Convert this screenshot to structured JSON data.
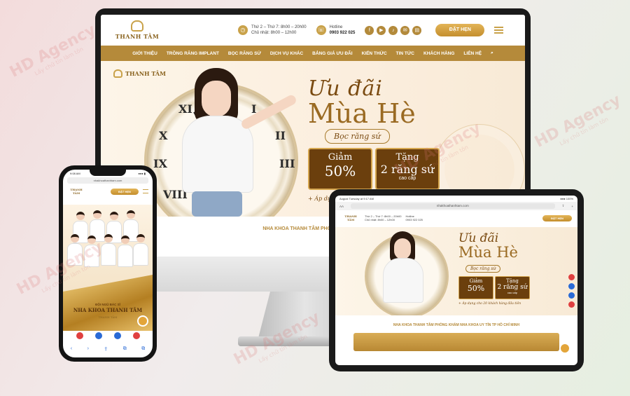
{
  "watermark": {
    "brand": "HD Agency",
    "tagline": "Lấy chữ tín làm tôn"
  },
  "desktop": {
    "logo_text": "THANH TÂM",
    "hours_line1": "Thứ 2 – Thứ 7: 8h00 – 20h00",
    "hours_line2": "Chủ nhật: 8h00 – 12h00",
    "hotline_label": "Hotline",
    "hotline": "0903 922 025",
    "socials": [
      "f",
      "▶",
      "♪",
      "✉",
      "▤"
    ],
    "book_button": "ĐẶT HẸN",
    "nav": [
      "GIỚI THIỆU",
      "TRỒNG RĂNG IMPLANT",
      "BỌC RĂNG SỨ",
      "DỊCH VỤ KHÁC",
      "BẢNG GIÁ ƯU ĐÃI",
      "KIẾN THỨC",
      "TIN TỨC",
      "KHÁCH HÀNG",
      "LIÊN HỆ"
    ],
    "search_icon": "⌕",
    "hero": {
      "script_title": "Ưu đãi",
      "big_title": "Mùa Hè",
      "pill": "Bọc răng sứ",
      "box1_l1": "Giảm",
      "box1_l2": "50%",
      "box2_l1": "Tặng",
      "box2_l2": "2 răng sứ",
      "box2_l3": "cao cấp",
      "note": "+ Áp dụ"
    },
    "section_title": "NHA KHOA THANH TÂM PHÒNG KHÁM NH"
  },
  "tablet": {
    "status_left": "August Tuesday at 9:17 AM",
    "status_right": "●●● 100%",
    "url_left": "AA",
    "url": "nhakhoathanhtam.com",
    "logo_text": "THANH TÂM",
    "hours_line1": "Thứ 2 – Thứ 7: 8h00 – 20h00",
    "hours_line2": "Chủ nhật: 8h00 – 12h00",
    "hotline_label": "Hotline",
    "hotline": "0903 922 025",
    "book_button": "ĐẶT HẸN",
    "hero": {
      "script_title": "Ưu đãi",
      "big_title": "Mùa Hè",
      "pill": "Bọc răng sứ",
      "box1_l1": "Giảm",
      "box1_l2": "50%",
      "box2_l1": "Tặng",
      "box2_l2": "2 răng sứ",
      "box2_l3": "cao cấp",
      "note": "+ Áp dụng cho 20 khách hàng đầu tiên"
    },
    "section_title": "NHA KHOA THANH TÂM PHÒNG KHÁM NHA KHOA UY TÍN TP HỒ CHÍ MINH",
    "float_colors": [
      "#e04040",
      "#2a6ad6",
      "#2a6ad6",
      "#e04040"
    ]
  },
  "phone": {
    "status_time": "9:08 AM",
    "status_right": "●●● ▮",
    "url": "nhakhoathanhtam.com",
    "logo_text": "THANH TÂM",
    "book_button": "ĐẶT HẸN",
    "caption1": "ĐỘI NGŨ BÁC SĨ",
    "caption2": "NHA KHOA THANH TÂM",
    "caption3": "THANH TÂM",
    "fab_colors": [
      "#e04040",
      "#2a6ad6",
      "#2a6ad6",
      "#e04040"
    ],
    "toolbar": [
      "‹",
      "›",
      "⇪",
      "⧉",
      "⧉"
    ]
  }
}
